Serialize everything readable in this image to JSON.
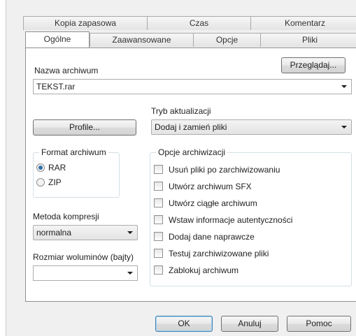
{
  "tabs_back": [
    {
      "label": "Kopia zapasowa"
    },
    {
      "label": "Czas"
    },
    {
      "label": "Komentarz"
    }
  ],
  "tabs_front": [
    {
      "label": "Ogólne",
      "active": true
    },
    {
      "label": "Zaawansowane"
    },
    {
      "label": "Opcje"
    },
    {
      "label": "Pliki"
    }
  ],
  "archive_name": {
    "label": "Nazwa archiwum",
    "value": "TEKST.rar",
    "browse_label": "Przeglądaj..."
  },
  "profiles_label": "Profile...",
  "update_mode": {
    "label": "Tryb aktualizacji",
    "value": "Dodaj i zamień pliki"
  },
  "archive_format": {
    "title": "Format archiwum",
    "options": [
      {
        "label": "RAR",
        "selected": true
      },
      {
        "label": "ZIP",
        "selected": false
      }
    ]
  },
  "compression": {
    "label": "Metoda kompresji",
    "value": "normalna"
  },
  "volume_size": {
    "label": "Rozmiar woluminów (bajty)",
    "value": ""
  },
  "archive_options": {
    "title": "Opcje archiwizacji",
    "items": [
      {
        "label": "Usuń pliki po zarchiwizowaniu",
        "checked": false
      },
      {
        "label": "Utwórz archiwum SFX",
        "checked": false
      },
      {
        "label": "Utwórz ciągłe archiwum",
        "checked": false
      },
      {
        "label": "Wstaw informacje autentyczności",
        "checked": false
      },
      {
        "label": "Dodaj dane naprawcze",
        "checked": false
      },
      {
        "label": "Testuj zarchiwizowane pliki",
        "checked": false
      },
      {
        "label": "Zablokuj archiwum",
        "checked": false
      }
    ]
  },
  "buttons": {
    "ok": "OK",
    "cancel": "Anuluj",
    "help": "Pomoc"
  },
  "colors": {
    "radio_selected": "#2f6fa8",
    "default_button_border": "#3c7fb1"
  }
}
